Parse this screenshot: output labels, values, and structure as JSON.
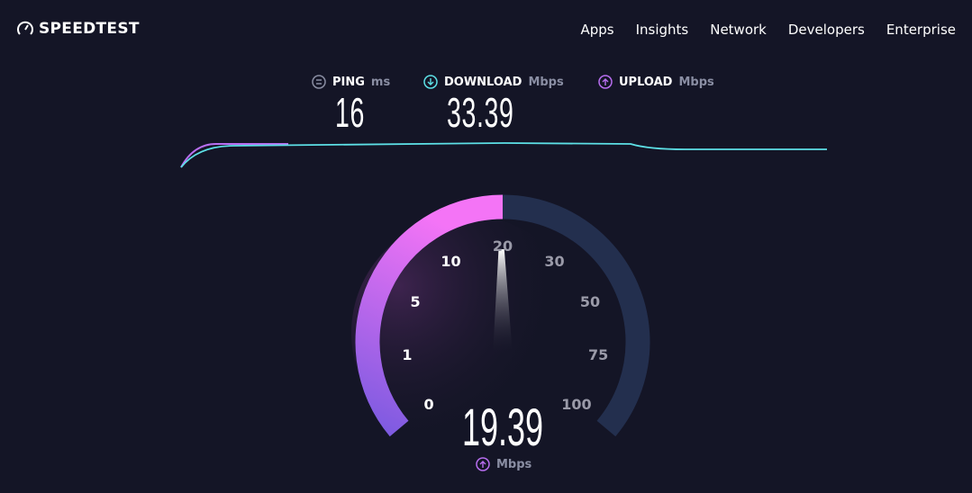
{
  "header": {
    "brand": "SPEEDTEST",
    "nav": [
      "Apps",
      "Insights",
      "Network",
      "Developers",
      "Enterprise"
    ]
  },
  "metrics": {
    "ping": {
      "label": "PING",
      "unit": "ms",
      "value": "16",
      "icon": "ping-icon",
      "color": "#8a8ea3"
    },
    "download": {
      "label": "DOWNLOAD",
      "unit": "Mbps",
      "value": "33.39",
      "icon": "download-arrow-icon",
      "color": "#5de0e6"
    },
    "upload": {
      "label": "UPLOAD",
      "unit": "Mbps",
      "value": "",
      "icon": "upload-arrow-icon",
      "color": "#b86ef0"
    }
  },
  "gauge": {
    "ticks": [
      "0",
      "1",
      "5",
      "10",
      "20",
      "30",
      "50",
      "75",
      "100"
    ],
    "current_value": "19.39",
    "unit": "Mbps",
    "needle_tick": "20",
    "fill_colors": [
      "#7b5ae0",
      "#f474f6"
    ],
    "track_color": "#232f4e"
  }
}
